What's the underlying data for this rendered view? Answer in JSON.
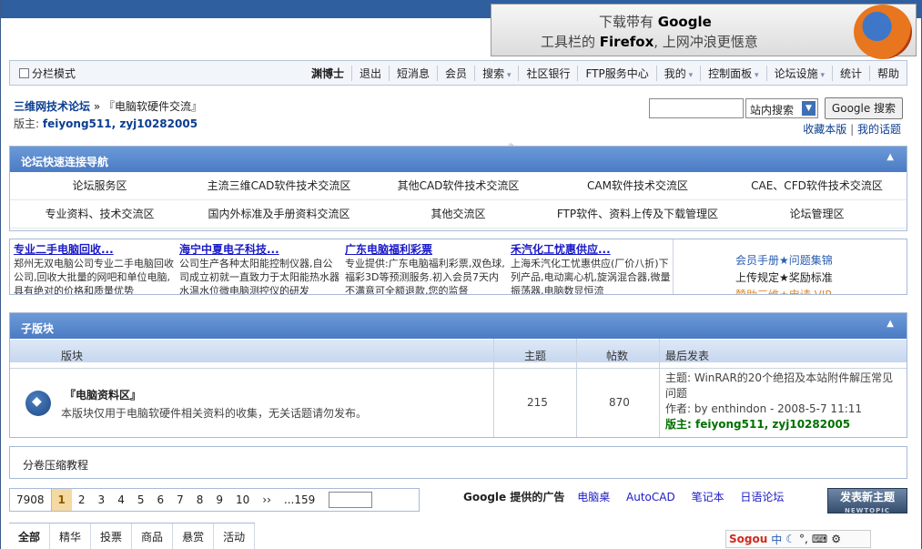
{
  "firefox_banner": {
    "line1_prefix": "下载带有",
    "line1_bold": "Google",
    "line2_prefix": "工具栏的",
    "line2_bold": "Firefox",
    "line2_suffix": ", 上网冲浪更惬意"
  },
  "menubar": {
    "split_mode": "分栏模式",
    "items": [
      "渊博士",
      "退出",
      "短消息",
      "会员",
      "搜索",
      "社区银行",
      "FTP服务中心",
      "我的",
      "控制面板",
      "论坛设施",
      "统计",
      "帮助"
    ]
  },
  "breadcrumb": {
    "home": "三维网技术论坛",
    "separator": "»",
    "current": "『电脑软硬件交流』"
  },
  "moderators": {
    "label": "版主:",
    "names": "feiyong511, zyj10282005"
  },
  "search": {
    "input_value": "",
    "scope": "站内搜索",
    "button": "Google 搜索"
  },
  "toplinks": {
    "archive": "收藏本版",
    "sep": "|",
    "my_topics": "我的话题"
  },
  "quicknav": {
    "title": "论坛快速连接导航",
    "items": [
      "论坛服务区",
      "主流三维CAD软件技术交流区",
      "其他CAD软件技术交流区",
      "CAM软件技术交流区",
      "CAE、CFD软件技术交流区",
      "专业资料、技术交流区",
      "国内外标准及手册资料交流区",
      "其他交流区",
      "FTP软件、资料上传及下载管理区",
      "论坛管理区"
    ]
  },
  "ads": [
    {
      "title": "专业二手电脑回收...",
      "desc": "郑州无双电脑公司专业二手电脑回收公司,回收大批量的网吧和单位电脑,具有绝对的价格和质量优势"
    },
    {
      "title": "海宁中夏电子科技...",
      "desc": "公司生产各种太阳能控制仪器,自公司成立初就一直致力于太阳能热水器水温水位微电脑测控仪的研发"
    },
    {
      "title": "广东电脑福利彩票",
      "desc": "专业提供:广东电脑福利彩票,双色球,福彩3D等预测服务.初入会员7天内不满意可全额退款,您的监督"
    },
    {
      "title": "禾汽化工忧惠供应...",
      "desc": "上海禾汽化工忧惠供应(厂价八折)下列产品,电动离心机,旋涡混合器,微量振荡器,电脑数显恒流"
    }
  ],
  "ad_side": [
    "会员手册★问题集锦",
    "上传规定★奖励标准",
    "赞助三维★申请 VIP"
  ],
  "subforums": {
    "title": "子版块",
    "headers": {
      "forum": "版块",
      "topics": "主题",
      "posts": "帖数",
      "last": "最后发表"
    },
    "row": {
      "name": "『电脑资料区』",
      "desc": "本版块仅用于电脑软硬件相关资料的收集，无关话题请勿发布。",
      "topics": "215",
      "posts": "870",
      "last_topic": "主题: WinRAR的20个绝招及本站附件解压常见问题",
      "last_author": "作者: by enthindon - 2008-5-7 11:11",
      "last_mod": "版主: feiyong511, zyj10282005"
    }
  },
  "archive_link": "分卷压缩教程",
  "pager": {
    "total": "7908",
    "current": "1",
    "pages": [
      "2",
      "3",
      "4",
      "5",
      "6",
      "7",
      "8",
      "9",
      "10"
    ],
    "next": "››",
    "last": "...159"
  },
  "google_ads": {
    "label": "Google 提供的广告",
    "links": [
      "电脑桌",
      "AutoCAD",
      "笔记本",
      "日语论坛"
    ]
  },
  "new_topic": {
    "label": "发表新主题",
    "sub": "NEWTOPIC"
  },
  "tabs": [
    "全部",
    "精华",
    "投票",
    "商品",
    "悬赏",
    "活动"
  ],
  "sogou": {
    "brand": "Sogou",
    "mode": "中"
  }
}
